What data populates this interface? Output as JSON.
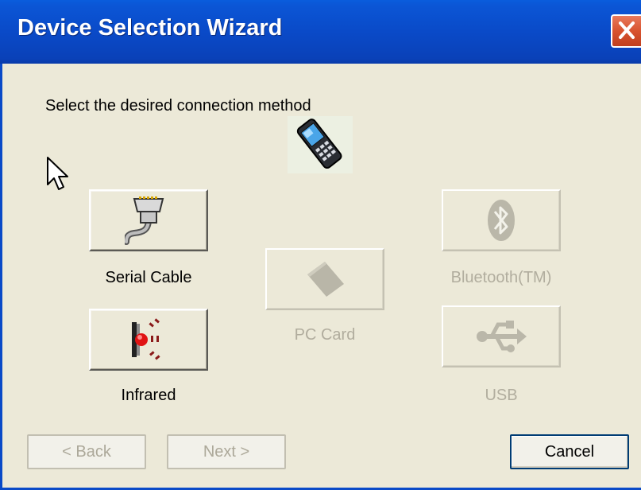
{
  "window": {
    "title": "Device Selection Wizard",
    "close_icon": "close-icon"
  },
  "main": {
    "instruction": "Select the desired connection method",
    "device_icon": "handheld-device-icon"
  },
  "options": {
    "serial": {
      "label": "Serial Cable",
      "icon": "serial-cable-icon",
      "enabled": true
    },
    "infrared": {
      "label": "Infrared",
      "icon": "infrared-icon",
      "enabled": true
    },
    "pc_card": {
      "label": "PC Card",
      "icon": "pc-card-icon",
      "enabled": false
    },
    "bluetooth": {
      "label": "Bluetooth(TM)",
      "icon": "bluetooth-icon",
      "enabled": false
    },
    "usb": {
      "label": "USB",
      "icon": "usb-icon",
      "enabled": false
    }
  },
  "buttons": {
    "back": {
      "label": "< Back",
      "enabled": false
    },
    "next": {
      "label": "Next >",
      "enabled": false
    },
    "cancel": {
      "label": "Cancel",
      "enabled": true
    }
  },
  "colors": {
    "title_bar": "#0a4ac8",
    "dialog_bg": "#ece9d8",
    "close_button": "#d8532f",
    "disabled_text": "#b1ad9e"
  }
}
